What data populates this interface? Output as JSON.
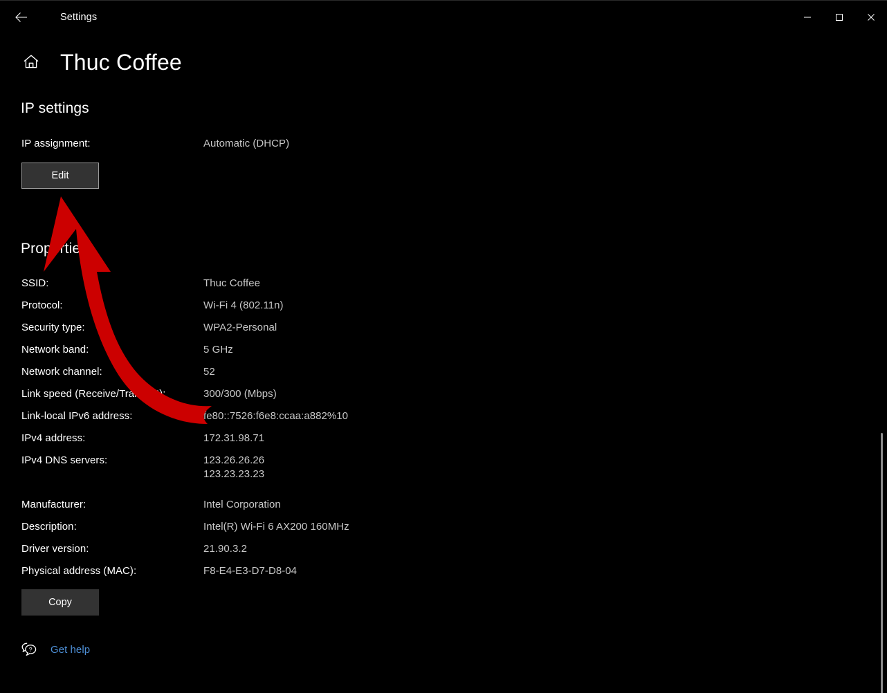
{
  "titlebar": {
    "back_label": "back-arrow",
    "title": "Settings",
    "minimize": "minimize",
    "maximize": "maximize",
    "close": "close"
  },
  "header": {
    "home_icon": "home-icon",
    "title": "Thuc Coffee"
  },
  "ip_settings": {
    "heading": "IP settings",
    "assignment_label": "IP assignment:",
    "assignment_value": "Automatic (DHCP)",
    "edit_button": "Edit"
  },
  "properties": {
    "heading": "Properties",
    "rows": [
      {
        "label": "SSID:",
        "value": "Thuc Coffee"
      },
      {
        "label": "Protocol:",
        "value": "Wi-Fi 4 (802.11n)"
      },
      {
        "label": "Security type:",
        "value": "WPA2-Personal"
      },
      {
        "label": "Network band:",
        "value": "5 GHz"
      },
      {
        "label": "Network channel:",
        "value": "52"
      },
      {
        "label": "Link speed (Receive/Transmit):",
        "value": "300/300 (Mbps)"
      },
      {
        "label": "Link-local IPv6 address:",
        "value": "fe80::7526:f6e8:ccaa:a882%10"
      },
      {
        "label": "IPv4 address:",
        "value": "172.31.98.71"
      },
      {
        "label": "IPv4 DNS servers:",
        "value": "123.26.26.26\n123.23.23.23"
      },
      {
        "label": "Manufacturer:",
        "value": "Intel Corporation"
      },
      {
        "label": "Description:",
        "value": "Intel(R) Wi-Fi 6 AX200 160MHz"
      },
      {
        "label": "Driver version:",
        "value": "21.90.3.2"
      },
      {
        "label": "Physical address (MAC):",
        "value": "F8-E4-E3-D7-D8-04"
      }
    ],
    "copy_button": "Copy"
  },
  "footer": {
    "help_icon": "help-bubble-icon",
    "help_link": "Get help"
  },
  "annotation": {
    "arrow_color": "#cc0000",
    "arrow_target": "edit-button"
  },
  "colors": {
    "background": "#000000",
    "label_text": "#ffffff",
    "value_text": "#c8c8c8",
    "button_fill": "#333333",
    "button_border": "#9a9a9a",
    "link": "#4d8fd6",
    "scrollbar": "#8b8b8b"
  }
}
